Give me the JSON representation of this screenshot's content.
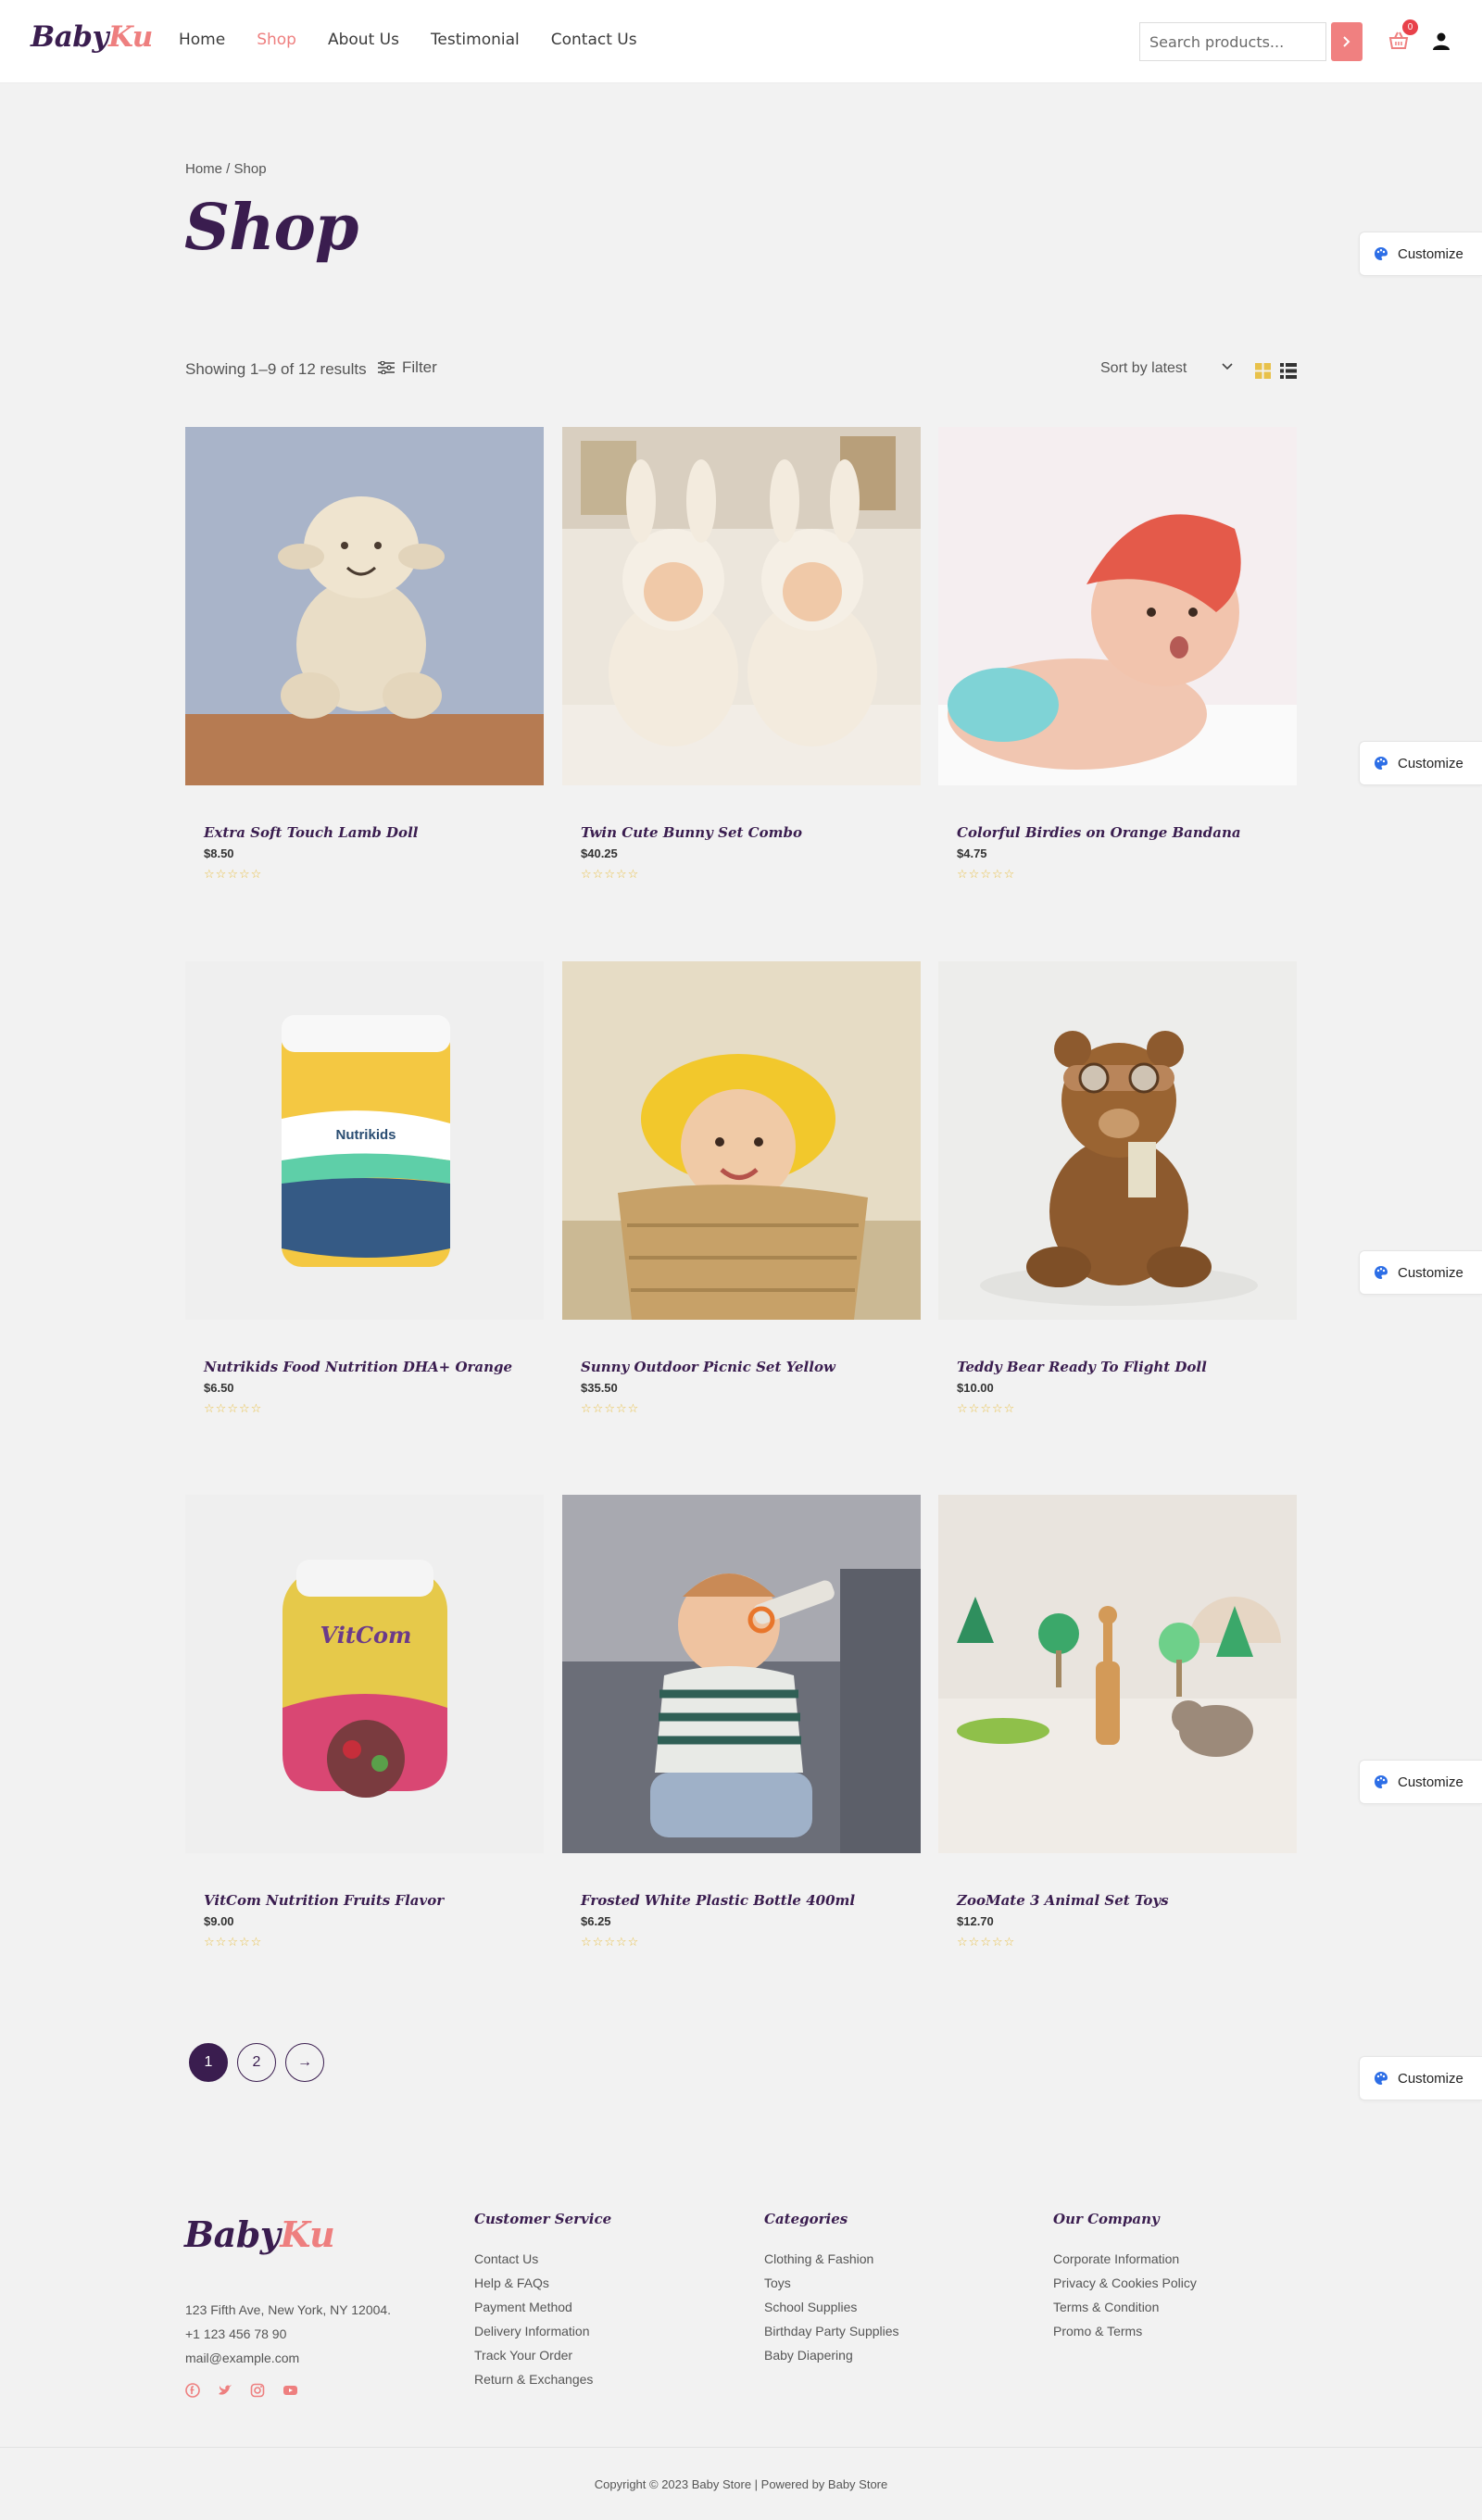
{
  "header": {
    "logo_part1": "Baby",
    "logo_part2": "Ku",
    "nav": [
      "Home",
      "Shop",
      "About Us",
      "Testimonial",
      "Contact Us"
    ],
    "active_nav": "Shop",
    "search_placeholder": "Search products...",
    "cart_count": "0"
  },
  "page": {
    "breadcrumb": "Home / Shop",
    "title": "Shop",
    "result_count": "Showing 1–9 of 12 results",
    "filter_label": "Filter",
    "sort_label": "Sort by latest"
  },
  "customize_label": "Customize",
  "products": [
    {
      "name": "Extra Soft Touch Lamb Doll",
      "price": "$8.50",
      "rating": 0
    },
    {
      "name": "Twin Cute Bunny Set Combo",
      "price": "$40.25",
      "rating": 0
    },
    {
      "name": "Colorful Birdies on Orange Bandana",
      "price": "$4.75",
      "rating": 0
    },
    {
      "name": "Nutrikids Food Nutrition DHA+ Orange",
      "price": "$6.50",
      "rating": 0
    },
    {
      "name": "Sunny Outdoor Picnic Set Yellow",
      "price": "$35.50",
      "rating": 0
    },
    {
      "name": "Teddy Bear Ready To Flight Doll",
      "price": "$10.00",
      "rating": 0
    },
    {
      "name": "VitCom Nutrition Fruits Flavor",
      "price": "$9.00",
      "rating": 0
    },
    {
      "name": "Frosted White Plastic Bottle 400ml",
      "price": "$6.25",
      "rating": 0
    },
    {
      "name": "ZooMate 3 Animal Set Toys",
      "price": "$12.70",
      "rating": 0
    }
  ],
  "product_images": {
    "nutrikids_label": "Nutrikids",
    "vitcom_label": "VitCom"
  },
  "pagination": {
    "pages": [
      "1",
      "2"
    ],
    "current": "1",
    "next": "→"
  },
  "footer": {
    "logo_part1": "Baby",
    "logo_part2": "Ku",
    "address": "123 Fifth Ave, New York, NY 12004.",
    "phone": "+1 123 456 78 90",
    "email": "mail@example.com",
    "columns": [
      {
        "title": "Customer Service",
        "links": [
          "Contact Us",
          "Help & FAQs",
          "Payment Method",
          "Delivery Information",
          "Track Your Order",
          "Return & Exchanges"
        ]
      },
      {
        "title": "Categories",
        "links": [
          "Clothing & Fashion",
          "Toys",
          "School Supplies",
          "Birthday Party Supplies",
          "Baby Diapering"
        ]
      },
      {
        "title": "Our Company",
        "links": [
          "Corporate Information",
          "Privacy & Cookies Policy",
          "Terms & Condition",
          "Promo & Terms"
        ]
      }
    ],
    "copyright": "Copyright © 2023 Baby Store | Powered by Baby Store"
  },
  "colors": {
    "brand_purple": "#3a1d4f",
    "brand_pink": "#ee7f7f",
    "star": "#e8c14a",
    "background": "#f2f2f2"
  }
}
